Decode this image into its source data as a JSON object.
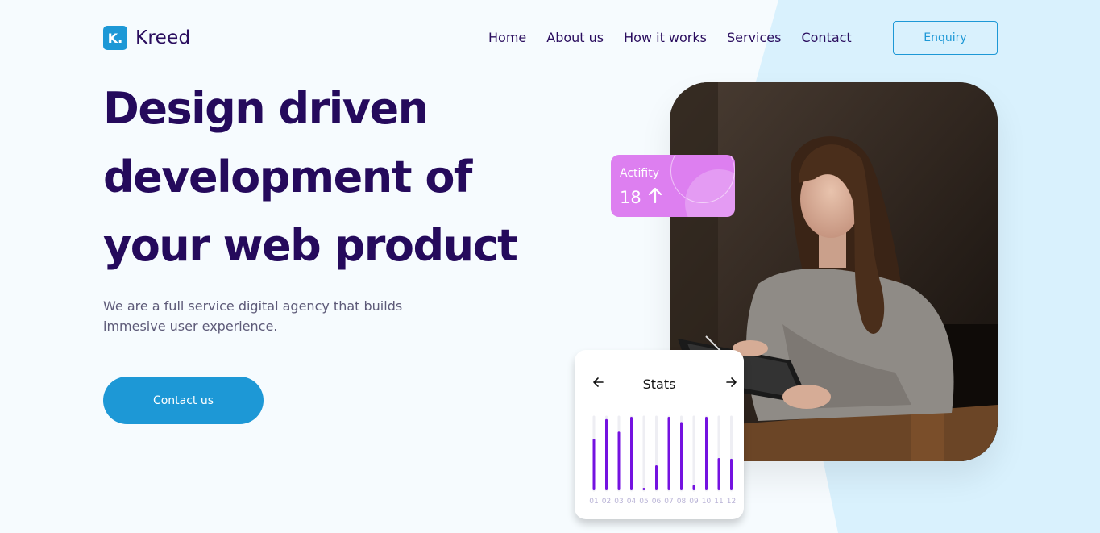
{
  "brand": {
    "logo_mark": "K.",
    "name": "Kreed"
  },
  "nav": {
    "items": [
      "Home",
      "About us",
      "How it works",
      "Services",
      "Contact"
    ],
    "enquiry_label": "Enquiry"
  },
  "hero": {
    "title_lines": [
      "Design driven",
      "development of",
      "your web product"
    ],
    "subtitle": "We are a full service digital agency that builds immesive user experience.",
    "cta_label": "Contact us"
  },
  "activity": {
    "label": "Actifity",
    "value": "18",
    "trend_icon": "arrow-up-icon"
  },
  "stats": {
    "title": "Stats",
    "prev_icon": "arrow-left-icon",
    "next_icon": "arrow-right-icon"
  },
  "chart_data": {
    "type": "bar",
    "categories": [
      "01",
      "02",
      "03",
      "04",
      "05",
      "06",
      "07",
      "08",
      "09",
      "10",
      "11",
      "12"
    ],
    "values": [
      70,
      97,
      80,
      100,
      3,
      34,
      100,
      93,
      7,
      100,
      44,
      43
    ],
    "ylim": [
      0,
      100
    ],
    "color": "#7412e0",
    "track_color": "#eeeef3"
  },
  "colors": {
    "accent": "#1d98d6",
    "heading": "#250a5c",
    "activity_card": "#dd7ff0",
    "background": "#f6fbfe",
    "background_shape": "#d9f1fd"
  }
}
